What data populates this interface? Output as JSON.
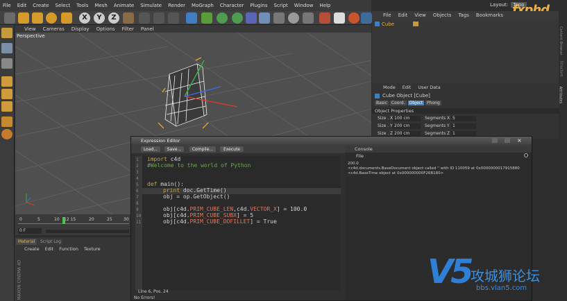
{
  "menubar": [
    "File",
    "Edit",
    "Create",
    "Select",
    "Tools",
    "Mesh",
    "Animate",
    "Simulate",
    "Render",
    "MoGraph",
    "Character",
    "Plugins",
    "Script",
    "Window",
    "Help"
  ],
  "layout": {
    "label": "Layout:",
    "value": "Topo"
  },
  "watermark_top": "fxphd",
  "viewport_menu": [
    "View",
    "Cameras",
    "Display",
    "Options",
    "Filter",
    "Panel"
  ],
  "viewport_label": "Perspective",
  "timeline": {
    "ticks": [
      "0",
      "5",
      "10",
      "12 15",
      "20",
      "25",
      "30"
    ],
    "frame": "0 F"
  },
  "materials": {
    "tabs": [
      "Material",
      "Script Log"
    ],
    "menu": [
      "Create",
      "Edit",
      "Function",
      "Texture"
    ]
  },
  "right_menu": [
    "File",
    "Edit",
    "View",
    "Objects",
    "Tags",
    "Bookmarks"
  ],
  "object_manager": {
    "item": "Cube"
  },
  "attributes": {
    "menu": [
      "Mode",
      "Edit",
      "User Data"
    ],
    "title": "Cube Object [Cube]",
    "tabs": [
      "Basic",
      "Coord.",
      "Object",
      "Phong"
    ],
    "section": "Object Properties",
    "rows": [
      {
        "label": "Size . X",
        "value": "100 cm",
        "seg_label": "Segments X",
        "seg_value": "5"
      },
      {
        "label": "Size . Y",
        "value": "200 cm",
        "seg_label": "Segments Y",
        "seg_value": "1"
      },
      {
        "label": "Size . Z",
        "value": "200 cm",
        "seg_label": "Segments Z",
        "seg_value": "1"
      }
    ]
  },
  "side_tabs": [
    "Content Browser",
    "Structure",
    "Attributes"
  ],
  "editor": {
    "title": "Expression Editor",
    "buttons": [
      "Load...",
      "Save...",
      "Compile...",
      "Execute"
    ],
    "line_numbers": [
      "1",
      "2",
      "3",
      "4",
      "5",
      "6",
      "7",
      "8",
      "9",
      "10",
      "11"
    ],
    "status_position": "Line 6, Pos. 24",
    "status_errors": "No Errors!"
  },
  "code": {
    "l1_kw": "import",
    "l1_rest": " c4d",
    "l2": "#Welcome to the world of Python",
    "l5_kw": "def",
    "l5_rest": " main():",
    "l6_kw": "print",
    "l6_rest": " doc.GetTime()",
    "l7": "obj = op.GetObject()",
    "l9_a": "obj[c4d.",
    "l9_c1": "PRIM_CUBE_LEN",
    "l9_b": ",c4d.",
    "l9_c2": "VECTOR_X",
    "l9_d": "] = 100.0",
    "l10_a": "obj[c4d.",
    "l10_c": "PRIM_CUBE_SUBX",
    "l10_b": "] = 5",
    "l11_a": "obj[c4d.",
    "l11_c": "PRIM_CUBE_DOFILLET",
    "l11_b": "] = True"
  },
  "console": {
    "title": "Console",
    "menu": "File",
    "lines": [
      "200.0",
      "<c4d.documents.BaseDocument object called '' with ID 110059 at 0x0000000017915880",
      "<c4d.BaseTime object at 0x000000000F26B180>"
    ]
  },
  "watermark": {
    "logo": "V5",
    "chinese": "攻城狮论坛",
    "url": "bbs.vlan5.com"
  },
  "corner_label": "MAXON CINEMA 4D",
  "colors": {
    "accent": "#4b7fb5",
    "panel": "#373737",
    "code_bg": "#2a2a2a",
    "tab_active": "#4b7fb5"
  }
}
